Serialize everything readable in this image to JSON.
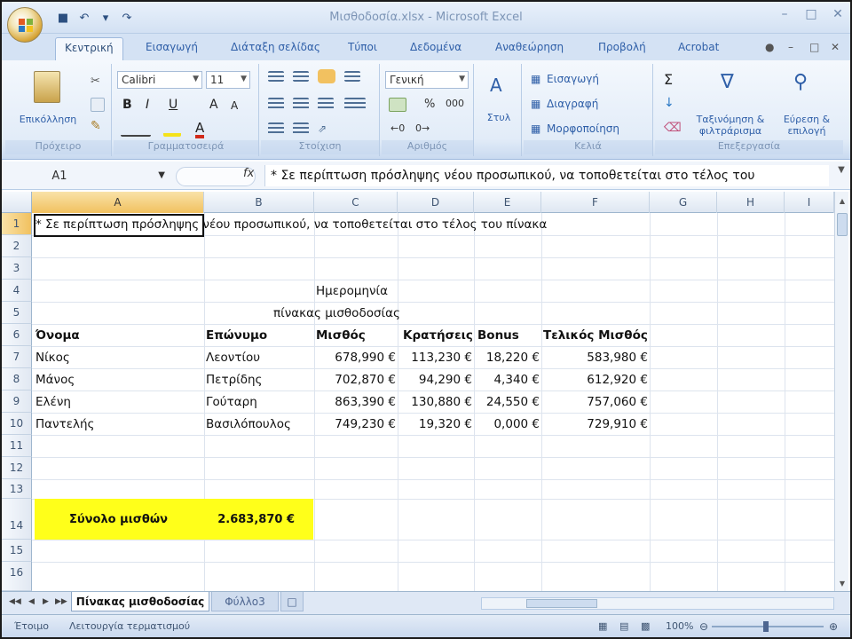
{
  "window": {
    "title": "Μισθοδοσία.xlsx - Microsoft Excel"
  },
  "ribbon_tabs": [
    "Κεντρική",
    "Εισαγωγή",
    "Διάταξη σελίδας",
    "Τύποι",
    "Δεδομένα",
    "Αναθεώρηση",
    "Προβολή",
    "Acrobat"
  ],
  "ribbon": {
    "paste_label": "Επικόλληση",
    "font_name": "Calibri",
    "font_size": "11",
    "number_format": "Γενική",
    "style_label": "Στυλ",
    "insert_label": "Εισαγωγή",
    "delete_label": "Διαγραφή",
    "format_label": "Μορφοποίηση",
    "sort_filter_label": "Ταξινόμηση & φιλτράρισμα",
    "find_select_label": "Εύρεση & επιλογή",
    "groups": {
      "clipboard": "Πρόχειρο",
      "font": "Γραμματοσειρά",
      "alignment": "Στοίχιση",
      "number": "Αριθμός",
      "cells": "Κελιά",
      "editing": "Επεξεργασία"
    }
  },
  "formula_bar": {
    "name_box": "A1",
    "fx": "fx",
    "content": "* Σε περίπτωση πρόσληψης νέου προσωπικού, να τοποθετείται στο τέλος του"
  },
  "columns": [
    "A",
    "B",
    "C",
    "D",
    "E",
    "F",
    "G",
    "H",
    "I"
  ],
  "rows": [
    "1",
    "2",
    "3",
    "4",
    "5",
    "6",
    "7",
    "8",
    "9",
    "10",
    "11",
    "12",
    "13",
    "14",
    "15",
    "16"
  ],
  "sheet": {
    "a1_note": "* Σε περίπτωση πρόσληψης νέου προσωπικού, να τοποθετείται στο τέλος του πίνακα",
    "date_label": "Ημερομηνία",
    "table_title": "πίνακας μισθοδοσίας",
    "headers": {
      "name": "Όνομα",
      "surname": "Επώνυμο",
      "salary": "Μισθός",
      "deductions": "Κρατήσεις",
      "bonus": "Bonus",
      "final_salary": "Τελικός Μισθός"
    },
    "employees": [
      {
        "name": "Νίκος",
        "surname": "Λεοντίου",
        "salary": "678,990 €",
        "deductions": "113,230 €",
        "bonus": "18,220 €",
        "final": "583,980 €"
      },
      {
        "name": "Μάνος",
        "surname": "Πετρίδης",
        "salary": "702,870 €",
        "deductions": "94,290 €",
        "bonus": "4,340 €",
        "final": "612,920 €"
      },
      {
        "name": "Ελένη",
        "surname": "Γούταρη",
        "salary": "863,390 €",
        "deductions": "130,880 €",
        "bonus": "24,550 €",
        "final": "757,060 €"
      },
      {
        "name": "Παντελής",
        "surname": "Βασιλόπουλος",
        "salary": "749,230 €",
        "deductions": "19,320 €",
        "bonus": "0,000 €",
        "final": "729,910 €"
      }
    ],
    "total_label": "Σύνολο μισθών",
    "total_value": "2.683,870 €"
  },
  "sheet_tabs": [
    "Πίνακας μισθοδοσίας",
    "Φύλλο3"
  ],
  "status": {
    "ready": "Έτοιμο",
    "mode": "Λειτουργία τερματισμού",
    "zoom": "100%"
  },
  "colors": {
    "ribbon_blue": "#d4e2f4",
    "total_highlight": "#ffff1a",
    "selection_header": "#f1c15f"
  }
}
